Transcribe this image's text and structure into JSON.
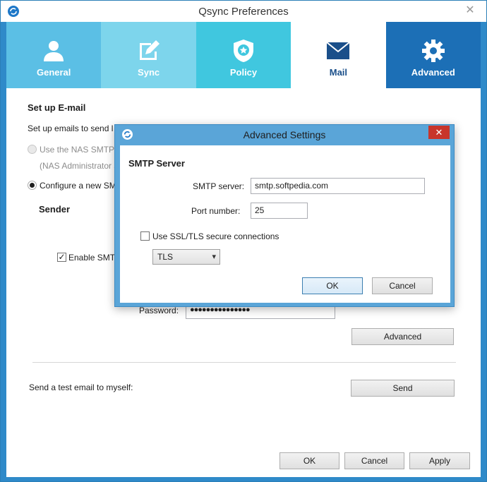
{
  "window": {
    "title": "Qsync Preferences",
    "close_glyph": "✕"
  },
  "tabs": [
    {
      "label": "General",
      "icon": "user-icon"
    },
    {
      "label": "Sync",
      "icon": "edit-sync-icon"
    },
    {
      "label": "Policy",
      "icon": "shield-icon"
    },
    {
      "label": "Mail",
      "icon": "mail-icon",
      "active": true
    },
    {
      "label": "Advanced",
      "icon": "gear-icon"
    }
  ],
  "mail": {
    "section_title": "Set up E-mail",
    "intro": "Set up emails to send l",
    "option_nas": "Use the NAS SMTP s",
    "option_nas_note": "(NAS Administrator s",
    "option_new": "Configure a new SM",
    "sender_title": "Sender",
    "enable_smtp": "Enable SMTP",
    "password_label": "Password:",
    "password_value": "●●●●●●●●●●●●●●●",
    "advanced_button": "Advanced",
    "test_label": "Send a test email to myself:",
    "send_button": "Send"
  },
  "footer": {
    "ok": "OK",
    "cancel": "Cancel",
    "apply": "Apply"
  },
  "dialog": {
    "title": "Advanced Settings",
    "close_glyph": "✕",
    "section_title": "SMTP Server",
    "smtp_label": "SMTP server:",
    "smtp_value": "smtp.softpedia.com",
    "port_label": "Port number:",
    "port_value": "25",
    "ssl_label": "Use SSL/TLS secure connections",
    "ssl_checked": false,
    "security_selected": "TLS",
    "ok": "OK",
    "cancel": "Cancel"
  },
  "colors": {
    "tab_general": "#5bbfe5",
    "tab_sync": "#7dd5ec",
    "tab_policy": "#40c7df",
    "tab_advanced": "#1c6fb6",
    "dialog_frame": "#5aa5d8",
    "close_red": "#c8352b"
  }
}
